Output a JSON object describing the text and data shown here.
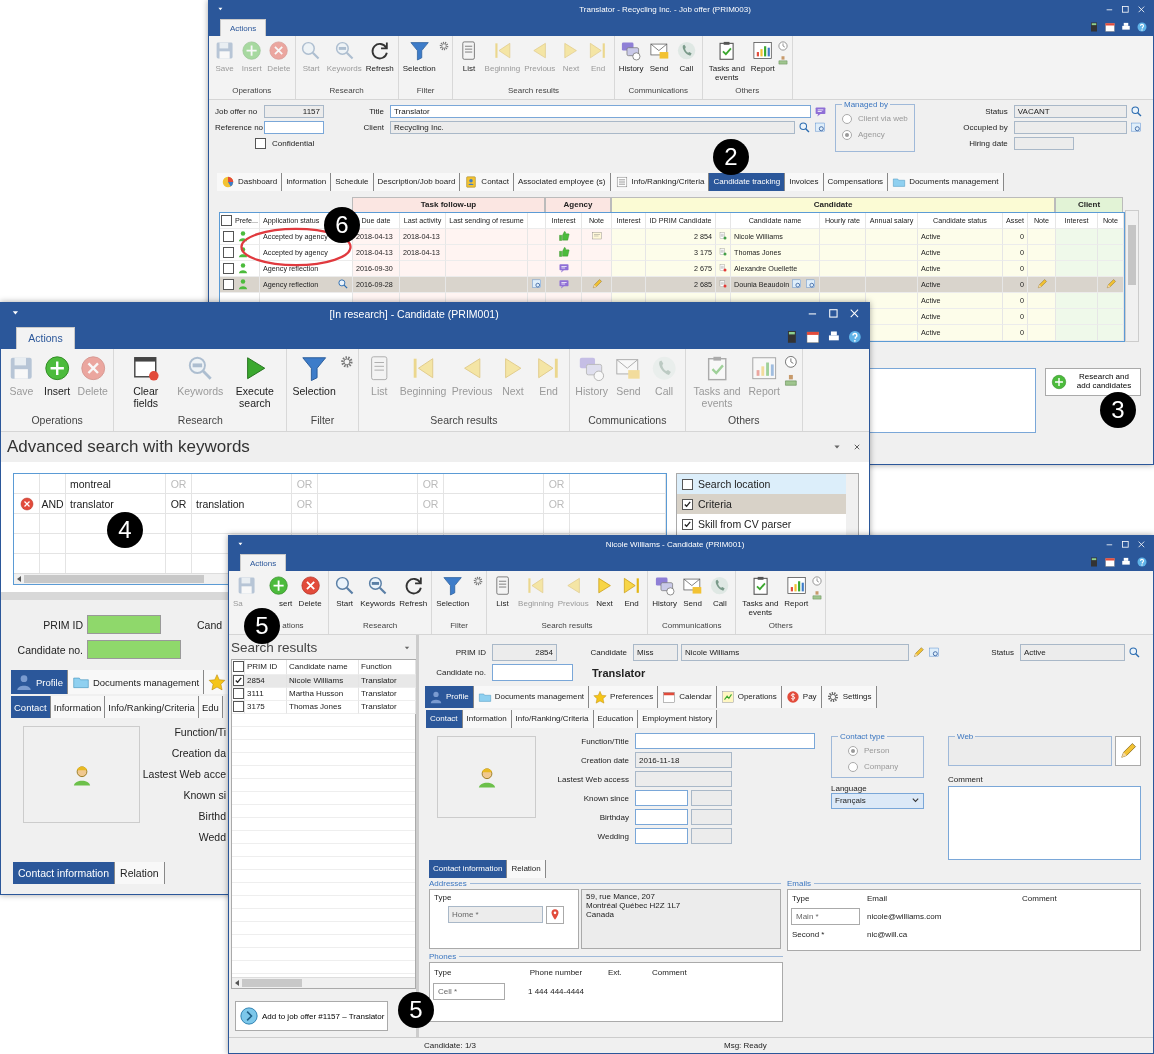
{
  "job_offer_window": {
    "title": "Translator - Recycling Inc. - Job offer (PRIM003)",
    "ribbon_tab": "Actions",
    "toolbar": [
      {
        "label": "Operations",
        "kind": "plain",
        "buttons": [
          {
            "kind": "save",
            "label": "Save",
            "disabled": true
          },
          {
            "kind": "insert",
            "label": "Insert",
            "disabled": true
          },
          {
            "kind": "delete",
            "label": "Delete",
            "disabled": true
          }
        ]
      },
      {
        "label": "Research",
        "kind": "plain",
        "buttons": [
          {
            "kind": "start",
            "label": "Start",
            "disabled": true
          },
          {
            "kind": "keywords",
            "label": "Keywords",
            "disabled": true
          },
          {
            "kind": "refresh",
            "label": "Refresh",
            "disabled": false
          }
        ]
      },
      {
        "label": "Filter",
        "kind": "filter",
        "buttons": [
          {
            "kind": "selection",
            "label": "Selection",
            "disabled": false
          }
        ]
      },
      {
        "label": "Search results",
        "kind": "plain",
        "buttons": [
          {
            "kind": "list",
            "label": "List",
            "disabled": false
          },
          {
            "kind": "beginning",
            "label": "Beginning",
            "disabled": true
          },
          {
            "kind": "previous",
            "label": "Previous",
            "disabled": true
          },
          {
            "kind": "next",
            "label": "Next",
            "disabled": true
          },
          {
            "kind": "end",
            "label": "End",
            "disabled": true
          }
        ]
      },
      {
        "label": "Communications",
        "kind": "plain",
        "buttons": [
          {
            "kind": "history",
            "label": "History",
            "disabled": false
          },
          {
            "kind": "send",
            "label": "Send",
            "disabled": false
          },
          {
            "kind": "call",
            "label": "Call",
            "disabled": false
          }
        ]
      },
      {
        "label": "Others",
        "kind": "others",
        "buttons": [
          {
            "kind": "tasks",
            "label": "Tasks and events",
            "disabled": false
          },
          {
            "kind": "report",
            "label": "Report",
            "disabled": false
          }
        ]
      }
    ],
    "form": {
      "job_offer_no": {
        "label": "Job offer no",
        "value": "1157"
      },
      "reference_no": {
        "label": "Reference no"
      },
      "confidential": {
        "label": "Confidential",
        "checked": false
      },
      "title": {
        "label": "Title",
        "value": "Translator"
      },
      "client": {
        "label": "Client",
        "value": "Recycling Inc."
      },
      "managed_by": {
        "label": "Managed by",
        "disabled": true,
        "options": [
          {
            "label": "Client via web",
            "selected": false
          },
          {
            "label": "Agency",
            "selected": true
          }
        ]
      },
      "status": {
        "label": "Status",
        "value": "VACANT"
      },
      "occupied_by": {
        "label": "Occupied by"
      },
      "hiring_date": {
        "label": "Hiring date"
      }
    },
    "tabs": [
      {
        "label": "Dashboard",
        "kind": "dashboard",
        "selected": false
      },
      {
        "label": "Information",
        "kind": "plain",
        "selected": false
      },
      {
        "label": "Schedule",
        "kind": "plain",
        "selected": false
      },
      {
        "label": "Description/Job board",
        "kind": "plain",
        "selected": false
      },
      {
        "label": "Contact",
        "kind": "contact",
        "selected": false
      },
      {
        "label": "Associated employee (s)",
        "kind": "plain",
        "selected": false
      },
      {
        "label": "Info/Ranking/Criteria",
        "kind": "criteria",
        "selected": false
      },
      {
        "label": "Candidate tracking",
        "kind": "plain",
        "selected": true
      },
      {
        "label": "Invoices",
        "kind": "plain",
        "selected": false
      },
      {
        "label": "Compensations",
        "kind": "plain",
        "selected": false
      },
      {
        "label": "Documents management",
        "kind": "documents",
        "selected": false
      }
    ],
    "tracking_table": {
      "groups": [
        {
          "label": "Task follow-up"
        },
        {
          "label": "Agency"
        },
        {
          "label": "Candidate"
        },
        {
          "label": "Client"
        }
      ],
      "select_all_checked": false,
      "columns": [
        "Prefe...",
        "Application status",
        "Due date",
        "Last activity",
        "Last sending of resume",
        "Interest",
        "Note",
        "Interest",
        "ID PRIM Candidate",
        "Candidate name",
        "Hourly rate",
        "Annual salary",
        "Candidate status",
        "Asset",
        "Note",
        "Interest",
        "Note"
      ],
      "rows": [
        {
          "checked": false,
          "selected": false,
          "application_status": "Accepted by agency",
          "due_date": "2018-04-13",
          "last_activity": "2018-04-13",
          "agency_liked": true,
          "agency_note": true,
          "id_prim": "2 854",
          "color": "#43a047",
          "candidate_name": "Nicole Williams",
          "candidate_status": "Active",
          "asset": "0"
        },
        {
          "checked": false,
          "selected": false,
          "application_status": "Accepted by agency",
          "due_date": "2018-04-13",
          "last_activity": "2018-04-13",
          "agency_liked": true,
          "agency_note": false,
          "id_prim": "3 175",
          "color": "#43a047",
          "candidate_name": "Thomas Jones",
          "candidate_status": "Active",
          "asset": "0"
        },
        {
          "checked": false,
          "selected": false,
          "application_status": "Agency reflection",
          "due_date": "2016-09-30",
          "agency_liked": false,
          "agency_note": false,
          "id_prim": "2 675",
          "color": "#e53935",
          "candidate_name": "Alexandre Ouellette",
          "candidate_status": "Active",
          "asset": "0"
        },
        {
          "checked": false,
          "selected": true,
          "application_status": "Agency reflection",
          "due_date": "2016-09-28",
          "agency_liked": false,
          "agency_note": false,
          "id_prim": "2 685",
          "color": "#e53935",
          "candidate_name": "Dounia Beaudoin",
          "candidate_status": "Active",
          "asset": "0"
        },
        {
          "selected": false,
          "candidate_status": "Active",
          "asset": "0"
        },
        {
          "selected": false,
          "candidate_status": "Active",
          "asset": "0"
        },
        {
          "selected": false,
          "candidate_status": "Active",
          "asset": "0"
        }
      ]
    },
    "research_button": "Research and add candidates"
  },
  "search_window": {
    "title": "[In research] - Candidate (PRIM001)",
    "ribbon_tab": "Actions",
    "toolbar": [
      {
        "label": "Operations",
        "kind": "plain",
        "buttons": [
          {
            "kind": "save",
            "label": "Save",
            "disabled": true
          },
          {
            "kind": "insert",
            "label": "Insert",
            "disabled": false
          },
          {
            "kind": "delete",
            "label": "Delete",
            "disabled": true
          }
        ]
      },
      {
        "label": "Research",
        "kind": "plain",
        "buttons": [
          {
            "kind": "clear",
            "label": "Clear fields",
            "disabled": false
          },
          {
            "kind": "keywords",
            "label": "Keywords",
            "disabled": true
          },
          {
            "kind": "execute",
            "label": "Execute search",
            "disabled": false
          }
        ]
      },
      {
        "label": "Filter",
        "kind": "filter",
        "buttons": [
          {
            "kind": "selection",
            "label": "Selection",
            "disabled": false
          }
        ]
      },
      {
        "label": "Search results",
        "kind": "plain",
        "buttons": [
          {
            "kind": "list",
            "label": "List",
            "disabled": true
          },
          {
            "kind": "beginning",
            "label": "Beginning",
            "disabled": true
          },
          {
            "kind": "previous",
            "label": "Previous",
            "disabled": true
          },
          {
            "kind": "next",
            "label": "Next",
            "disabled": true
          },
          {
            "kind": "end",
            "label": "End",
            "disabled": true
          }
        ]
      },
      {
        "label": "Communications",
        "kind": "plain",
        "buttons": [
          {
            "kind": "history",
            "label": "History",
            "disabled": true
          },
          {
            "kind": "send",
            "label": "Send",
            "disabled": true
          },
          {
            "kind": "call",
            "label": "Call",
            "disabled": true
          }
        ]
      },
      {
        "label": "Others",
        "kind": "others",
        "buttons": [
          {
            "kind": "tasks",
            "label": "Tasks and events",
            "disabled": true
          },
          {
            "kind": "report",
            "label": "Report",
            "disabled": true
          }
        ]
      }
    ],
    "advanced_search": {
      "title": "Advanced search with keywords",
      "rows": [
        {
          "removable": false,
          "cells": [
            {
              "kind": "term",
              "text": "montreal"
            },
            {
              "kind": "or",
              "text": "OR",
              "active": false
            },
            {
              "kind": "term"
            },
            {
              "kind": "or",
              "text": "OR",
              "active": false
            },
            {
              "kind": "term"
            },
            {
              "kind": "or",
              "text": "OR",
              "active": false
            },
            {
              "kind": "term"
            },
            {
              "kind": "or",
              "text": "OR",
              "active": false
            },
            {
              "kind": "term"
            }
          ]
        },
        {
          "removable": true,
          "operator": "AND",
          "cells": [
            {
              "kind": "term",
              "text": "translator"
            },
            {
              "kind": "or",
              "text": "OR",
              "active": true
            },
            {
              "kind": "term",
              "text": "translation"
            },
            {
              "kind": "or",
              "text": "OR",
              "active": false
            },
            {
              "kind": "term"
            },
            {
              "kind": "or",
              "text": "OR",
              "active": false
            },
            {
              "kind": "term"
            },
            {
              "kind": "or",
              "text": "OR",
              "active": false
            },
            {
              "kind": "term"
            }
          ]
        }
      ],
      "options": [
        {
          "label": "Search location",
          "checked": false,
          "selected": false,
          "focused": true
        },
        {
          "label": "Criteria",
          "checked": true,
          "selected": true,
          "focused": false
        },
        {
          "label": "Skill from CV parser",
          "checked": true,
          "selected": false,
          "focused": false
        }
      ]
    },
    "candidate_form": {
      "prim_id": {
        "label": "PRIM ID",
        "highlighted": true
      },
      "candidate_no": {
        "label": "Candidate no.",
        "highlighted": true
      },
      "candidate_label": "Cand",
      "tabs": [
        {
          "label": "Profile",
          "kind": "profile",
          "selected": true
        },
        {
          "label": "Documents management",
          "kind": "documents",
          "selected": false
        },
        {
          "kind": "preferences",
          "selected": false
        }
      ],
      "subtabs": [
        {
          "label": "Contact",
          "selected": true
        },
        {
          "label": "Information",
          "selected": false
        },
        {
          "label": "Info/Ranking/Criteria",
          "selected": false
        },
        {
          "label": "Edu",
          "selected": false
        }
      ],
      "field_labels": [
        "Function/Ti",
        "Creation da",
        "Lastest Web acce",
        "Known si",
        "Birthd",
        "Wedd"
      ],
      "contact_tabs": [
        {
          "label": "Contact information",
          "selected": true
        },
        {
          "label": "Relation",
          "selected": false
        }
      ]
    }
  },
  "candidate_window": {
    "title": "Nicole Williams - Candidate (PRIM001)",
    "ribbon_tab": "Actions",
    "toolbar": [
      {
        "label": "ations",
        "kind": "plain",
        "buttons": [
          {
            "kind": "save",
            "label": "Sa",
            "disabled": true
          },
          {
            "kind": "insert",
            "label": "sert",
            "disabled": false
          },
          {
            "kind": "delete",
            "label": "Delete",
            "disabled": false
          }
        ]
      },
      {
        "label": "Research",
        "kind": "plain",
        "buttons": [
          {
            "kind": "start",
            "label": "Start",
            "disabled": false
          },
          {
            "kind": "keywords",
            "label": "Keywords",
            "disabled": false
          },
          {
            "kind": "refresh",
            "label": "Refresh",
            "disabled": false
          }
        ]
      },
      {
        "label": "Filter",
        "kind": "filter",
        "buttons": [
          {
            "kind": "selection",
            "label": "Selection",
            "disabled": false
          }
        ]
      },
      {
        "label": "Search results",
        "kind": "plain",
        "buttons": [
          {
            "kind": "list",
            "label": "List",
            "disabled": false
          },
          {
            "kind": "beginning",
            "label": "Beginning",
            "disabled": true
          },
          {
            "kind": "previous",
            "label": "Previous",
            "disabled": true
          },
          {
            "kind": "next",
            "label": "Next",
            "disabled": false
          },
          {
            "kind": "end",
            "label": "End",
            "disabled": false
          }
        ]
      },
      {
        "label": "Communications",
        "kind": "plain",
        "buttons": [
          {
            "kind": "history",
            "label": "History",
            "disabled": false
          },
          {
            "kind": "send",
            "label": "Send",
            "disabled": false
          },
          {
            "kind": "call",
            "label": "Call",
            "disabled": false
          }
        ]
      },
      {
        "label": "Others",
        "kind": "others",
        "buttons": [
          {
            "kind": "tasks",
            "label": "Tasks and events",
            "disabled": false
          },
          {
            "kind": "report",
            "label": "Report",
            "disabled": false
          }
        ]
      }
    ],
    "search_results": {
      "title": "Search results",
      "columns": [
        "PRIM ID",
        "Candidate name",
        "Function"
      ],
      "select_all_checked": false,
      "rows": [
        {
          "checked": true,
          "selected": true,
          "prim_id": "2854",
          "name": "Nicole Williams",
          "function": "Translator"
        },
        {
          "checked": false,
          "selected": false,
          "prim_id": "3111",
          "name": "Martha Husson",
          "function": "Translator"
        },
        {
          "checked": false,
          "selected": false,
          "prim_id": "3175",
          "name": "Thomas Jones",
          "function": "Translator"
        }
      ],
      "add_button": "Add to job offer #1157 – Translator"
    },
    "header": {
      "prim_id_label": "PRIM ID",
      "prim_id": "2854",
      "candidate_label": "Candidate",
      "salutation": "Miss",
      "name": "Nicole Williams",
      "status_label": "Status",
      "status": "Active",
      "candidate_no_label": "Candidate no.",
      "function_title": "Translator"
    },
    "tabs": [
      {
        "label": "Profile",
        "kind": "profile",
        "selected": true
      },
      {
        "label": "Documents management",
        "kind": "documents",
        "selected": false
      },
      {
        "label": "Preferences",
        "kind": "preferences",
        "selected": false
      },
      {
        "label": "Calendar",
        "kind": "calendar",
        "selected": false
      },
      {
        "label": "Operations",
        "kind": "operations",
        "selected": false
      },
      {
        "label": "Pay",
        "kind": "pay",
        "selected": false
      },
      {
        "label": "Settings",
        "kind": "settings",
        "selected": false
      }
    ],
    "subtabs": [
      {
        "label": "Contact",
        "selected": true
      },
      {
        "label": "Information",
        "selected": false
      },
      {
        "label": "Info/Ranking/Criteria",
        "selected": false
      },
      {
        "label": "Education",
        "selected": false
      },
      {
        "label": "Employment history",
        "selected": false
      }
    ],
    "fields": [
      {
        "label": "Function/Title",
        "kind": "wide"
      },
      {
        "label": "Creation date",
        "kind": "readonly",
        "value": "2016-11-18"
      },
      {
        "label": "Lastest Web access",
        "kind": "readonly"
      },
      {
        "label": "Known since",
        "kind": "double"
      },
      {
        "label": "Birthday",
        "kind": "double"
      },
      {
        "label": "Wedding",
        "kind": "double"
      }
    ],
    "contact_type": {
      "label": "Contact type",
      "disabled": true,
      "options": [
        {
          "label": "Person",
          "selected": true
        },
        {
          "label": "Company",
          "selected": false
        }
      ]
    },
    "language": {
      "label": "Language",
      "value": "Français"
    },
    "web_label": "Web",
    "comment_label": "Comment",
    "contact_tabs": [
      {
        "label": "Contact information",
        "selected": true
      },
      {
        "label": "Relation",
        "selected": false
      }
    ],
    "addresses": {
      "label": "Addresses",
      "type_header": "Type",
      "type": "Home *",
      "lines": [
        "59, rue Mance, 207",
        "Montréal Québec H2Z 1L7",
        "Canada"
      ]
    },
    "emails": {
      "label": "Emails",
      "columns": [
        "Type",
        "Email",
        "Comment"
      ],
      "rows": [
        {
          "type": "Main *",
          "email": "nicole@williams.com",
          "selected": true
        },
        {
          "type": "Second *",
          "email": "nic@will.ca",
          "selected": false
        }
      ]
    },
    "phones": {
      "label": "Phones",
      "columns": [
        "Type",
        "Phone number",
        "Ext.",
        "Comment"
      ],
      "rows": [
        {
          "type": "Cell *",
          "phone": "1 444 444-4444",
          "selected": true
        }
      ]
    },
    "status_bar": [
      "Candidate: 1/3",
      "Msg: Ready"
    ]
  },
  "annotations": [
    {
      "label": "2"
    },
    {
      "label": "3"
    },
    {
      "label": "4"
    },
    {
      "label": "5"
    },
    {
      "label": "5"
    },
    {
      "label": "6"
    }
  ]
}
